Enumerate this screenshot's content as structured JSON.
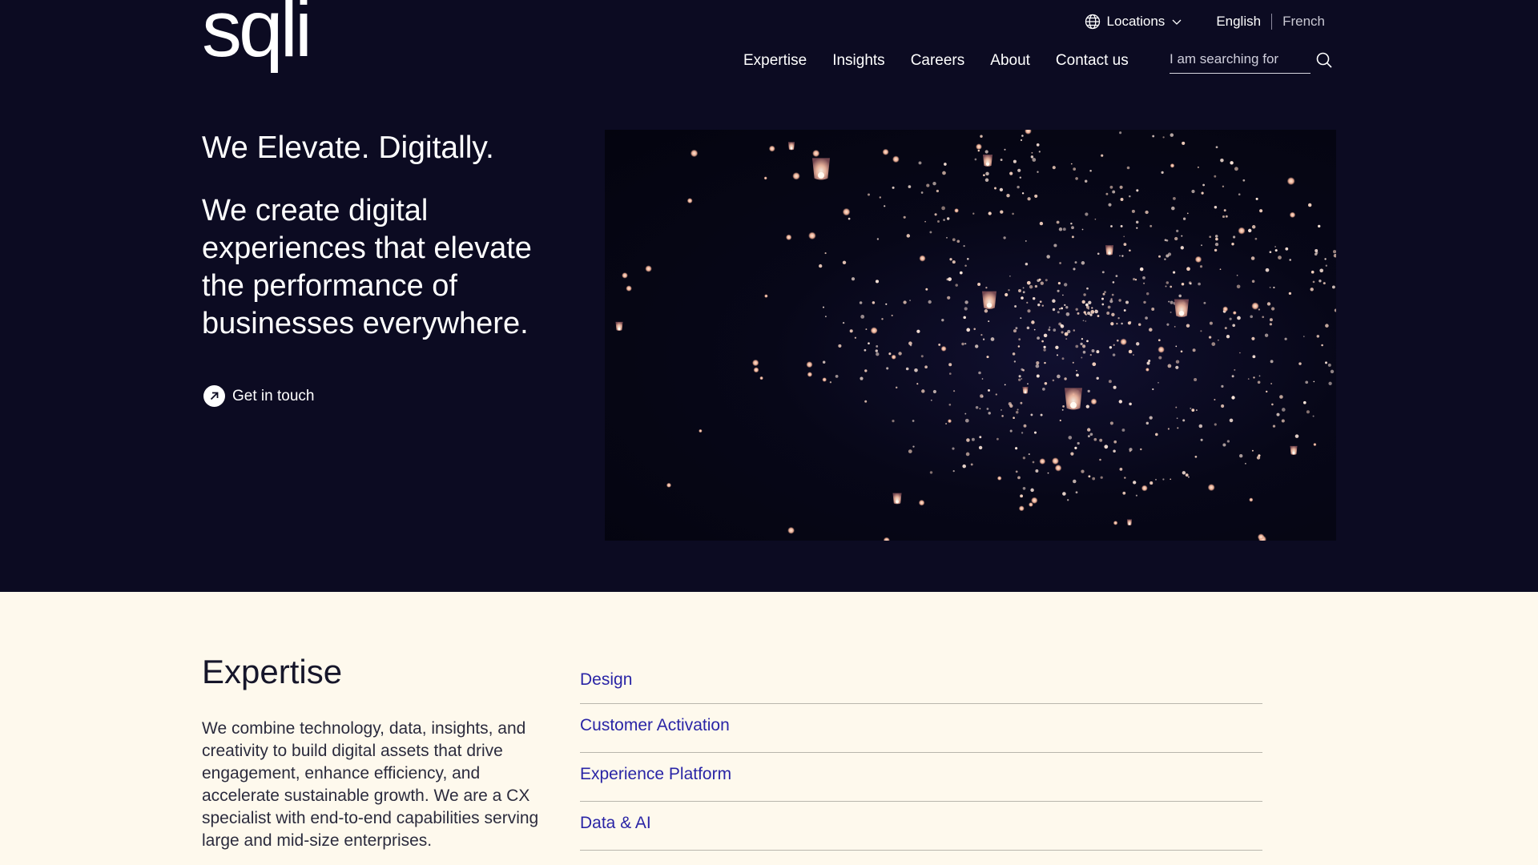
{
  "brand": {
    "logo_text": "sqli"
  },
  "header": {
    "locations_label": "Locations",
    "languages": {
      "active": "English",
      "inactive": "French"
    },
    "nav": [
      "Expertise",
      "Insights",
      "Careers",
      "About",
      "Contact us"
    ],
    "search_placeholder": "I am searching for"
  },
  "hero": {
    "tagline": "We Elevate. Digitally.",
    "lead": "We create digital experiences that elevate the performance of businesses everywhere.",
    "cta_label": "Get in touch"
  },
  "expertise": {
    "title": "Expertise",
    "description": "We combine technology, data, insights, and creativity to build digital assets that drive engagement, enhance efficiency, and accelerate sustainable growth. We are a CX specialist with end-to-end capabilities serving large and mid-size enterprises.",
    "items": [
      "Design",
      "Customer Activation",
      "Experience Platform",
      "Data & AI"
    ]
  },
  "colors": {
    "hero_bg": "#0c0b22",
    "page_bg": "#fef9ed",
    "link": "#2a25a6"
  }
}
